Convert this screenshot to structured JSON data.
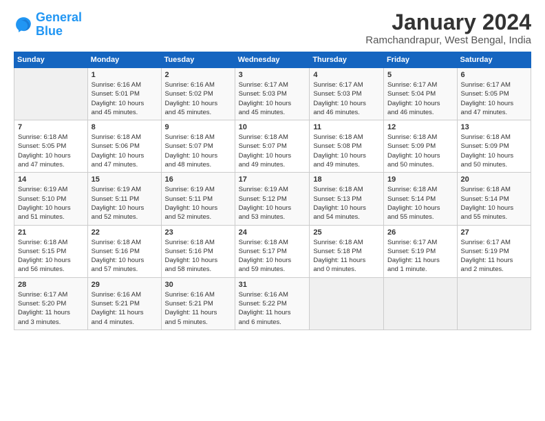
{
  "logo": {
    "line1": "General",
    "line2": "Blue"
  },
  "header": {
    "month": "January 2024",
    "location": "Ramchandrapur, West Bengal, India"
  },
  "weekdays": [
    "Sunday",
    "Monday",
    "Tuesday",
    "Wednesday",
    "Thursday",
    "Friday",
    "Saturday"
  ],
  "weeks": [
    [
      {
        "day": "",
        "info": ""
      },
      {
        "day": "1",
        "info": "Sunrise: 6:16 AM\nSunset: 5:01 PM\nDaylight: 10 hours\nand 45 minutes."
      },
      {
        "day": "2",
        "info": "Sunrise: 6:16 AM\nSunset: 5:02 PM\nDaylight: 10 hours\nand 45 minutes."
      },
      {
        "day": "3",
        "info": "Sunrise: 6:17 AM\nSunset: 5:03 PM\nDaylight: 10 hours\nand 45 minutes."
      },
      {
        "day": "4",
        "info": "Sunrise: 6:17 AM\nSunset: 5:03 PM\nDaylight: 10 hours\nand 46 minutes."
      },
      {
        "day": "5",
        "info": "Sunrise: 6:17 AM\nSunset: 5:04 PM\nDaylight: 10 hours\nand 46 minutes."
      },
      {
        "day": "6",
        "info": "Sunrise: 6:17 AM\nSunset: 5:05 PM\nDaylight: 10 hours\nand 47 minutes."
      }
    ],
    [
      {
        "day": "7",
        "info": "Sunrise: 6:18 AM\nSunset: 5:05 PM\nDaylight: 10 hours\nand 47 minutes."
      },
      {
        "day": "8",
        "info": "Sunrise: 6:18 AM\nSunset: 5:06 PM\nDaylight: 10 hours\nand 47 minutes."
      },
      {
        "day": "9",
        "info": "Sunrise: 6:18 AM\nSunset: 5:07 PM\nDaylight: 10 hours\nand 48 minutes."
      },
      {
        "day": "10",
        "info": "Sunrise: 6:18 AM\nSunset: 5:07 PM\nDaylight: 10 hours\nand 49 minutes."
      },
      {
        "day": "11",
        "info": "Sunrise: 6:18 AM\nSunset: 5:08 PM\nDaylight: 10 hours\nand 49 minutes."
      },
      {
        "day": "12",
        "info": "Sunrise: 6:18 AM\nSunset: 5:09 PM\nDaylight: 10 hours\nand 50 minutes."
      },
      {
        "day": "13",
        "info": "Sunrise: 6:18 AM\nSunset: 5:09 PM\nDaylight: 10 hours\nand 50 minutes."
      }
    ],
    [
      {
        "day": "14",
        "info": "Sunrise: 6:19 AM\nSunset: 5:10 PM\nDaylight: 10 hours\nand 51 minutes."
      },
      {
        "day": "15",
        "info": "Sunrise: 6:19 AM\nSunset: 5:11 PM\nDaylight: 10 hours\nand 52 minutes."
      },
      {
        "day": "16",
        "info": "Sunrise: 6:19 AM\nSunset: 5:11 PM\nDaylight: 10 hours\nand 52 minutes."
      },
      {
        "day": "17",
        "info": "Sunrise: 6:19 AM\nSunset: 5:12 PM\nDaylight: 10 hours\nand 53 minutes."
      },
      {
        "day": "18",
        "info": "Sunrise: 6:18 AM\nSunset: 5:13 PM\nDaylight: 10 hours\nand 54 minutes."
      },
      {
        "day": "19",
        "info": "Sunrise: 6:18 AM\nSunset: 5:14 PM\nDaylight: 10 hours\nand 55 minutes."
      },
      {
        "day": "20",
        "info": "Sunrise: 6:18 AM\nSunset: 5:14 PM\nDaylight: 10 hours\nand 55 minutes."
      }
    ],
    [
      {
        "day": "21",
        "info": "Sunrise: 6:18 AM\nSunset: 5:15 PM\nDaylight: 10 hours\nand 56 minutes."
      },
      {
        "day": "22",
        "info": "Sunrise: 6:18 AM\nSunset: 5:16 PM\nDaylight: 10 hours\nand 57 minutes."
      },
      {
        "day": "23",
        "info": "Sunrise: 6:18 AM\nSunset: 5:16 PM\nDaylight: 10 hours\nand 58 minutes."
      },
      {
        "day": "24",
        "info": "Sunrise: 6:18 AM\nSunset: 5:17 PM\nDaylight: 10 hours\nand 59 minutes."
      },
      {
        "day": "25",
        "info": "Sunrise: 6:18 AM\nSunset: 5:18 PM\nDaylight: 11 hours\nand 0 minutes."
      },
      {
        "day": "26",
        "info": "Sunrise: 6:17 AM\nSunset: 5:19 PM\nDaylight: 11 hours\nand 1 minute."
      },
      {
        "day": "27",
        "info": "Sunrise: 6:17 AM\nSunset: 5:19 PM\nDaylight: 11 hours\nand 2 minutes."
      }
    ],
    [
      {
        "day": "28",
        "info": "Sunrise: 6:17 AM\nSunset: 5:20 PM\nDaylight: 11 hours\nand 3 minutes."
      },
      {
        "day": "29",
        "info": "Sunrise: 6:16 AM\nSunset: 5:21 PM\nDaylight: 11 hours\nand 4 minutes."
      },
      {
        "day": "30",
        "info": "Sunrise: 6:16 AM\nSunset: 5:21 PM\nDaylight: 11 hours\nand 5 minutes."
      },
      {
        "day": "31",
        "info": "Sunrise: 6:16 AM\nSunset: 5:22 PM\nDaylight: 11 hours\nand 6 minutes."
      },
      {
        "day": "",
        "info": ""
      },
      {
        "day": "",
        "info": ""
      },
      {
        "day": "",
        "info": ""
      }
    ]
  ]
}
